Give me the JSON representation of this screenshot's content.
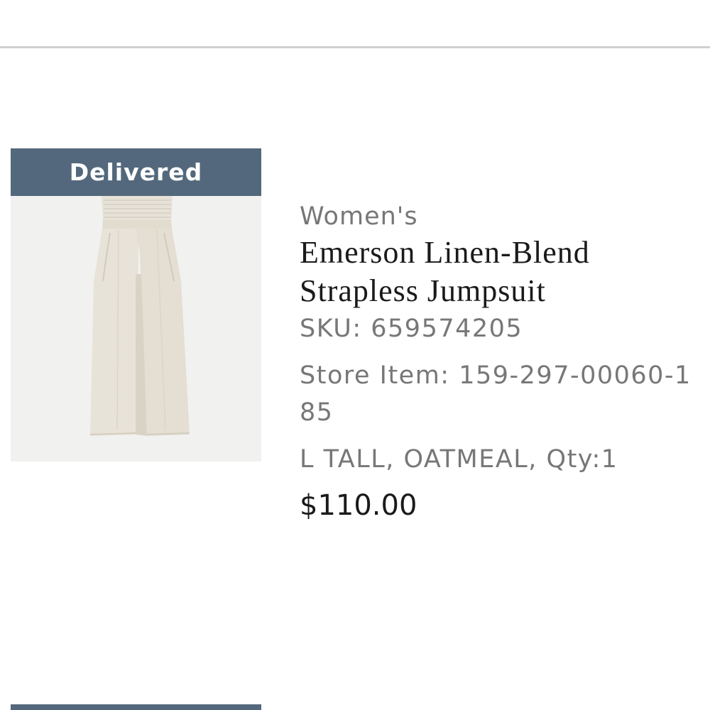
{
  "order_item": {
    "status": "Delivered",
    "category": "Women's",
    "product_name": "Emerson Linen-Blend Strapless Jumpsuit",
    "sku": "SKU: 659574205",
    "store_item": "Store Item: 159-297-00060-185",
    "variant": "L TALL, OATMEAL, Qty:1",
    "price": "$110.00"
  },
  "colors": {
    "status_banner": "#53687c",
    "divider": "#d0d0d0",
    "secondary_text": "#777777",
    "primary_text": "#1a1a1a",
    "product_color": "#e6e0d5"
  }
}
